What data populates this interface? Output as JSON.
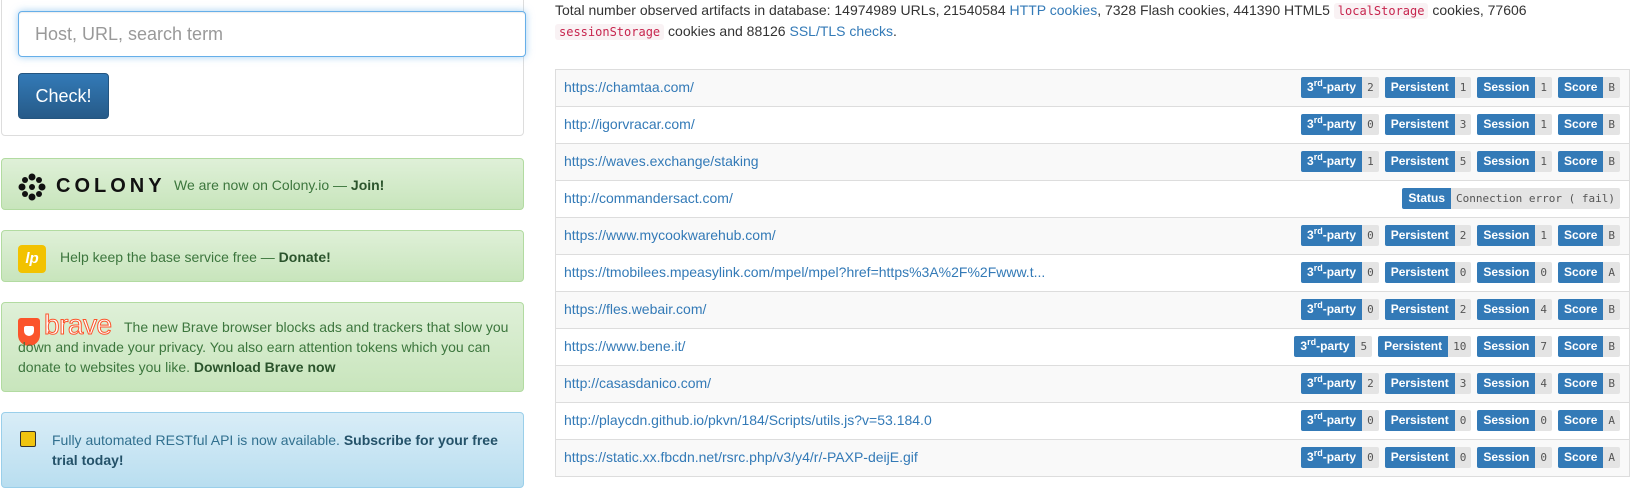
{
  "search": {
    "placeholder": "Host, URL, search term",
    "button_label": "Check!"
  },
  "colony": {
    "brand": "COLONY",
    "text": "We are now on Colony.io — ",
    "link": "Join!"
  },
  "donate": {
    "icon_text": "lp",
    "text": "Help keep the base service free — ",
    "link": "Donate!"
  },
  "brave": {
    "brand": "brave",
    "text": "The new Brave browser blocks ads and trackers that slow you down and invade your privacy. You also earn attention tokens which you can donate to websites you like. ",
    "link": "Download Brave now"
  },
  "api": {
    "text": "Fully automated RESTful API is now available. ",
    "link": "Subscribe for your free trial today!"
  },
  "stats": {
    "t1": "Total number observed artifacts in database: 14974989 URLs, 21540584 ",
    "l1": "HTTP cookies",
    "t2": ", 7328 Flash cookies, 441390 HTML5 ",
    "c1": "localStorage",
    "t3": " cookies, 77606 ",
    "c2": "sessionStorage",
    "t4": " cookies and 88126 ",
    "l2": "SSL/TLS checks",
    "t5": "."
  },
  "labels": {
    "third_sup": "rd",
    "third_pre": "3",
    "third_post": "-party",
    "persistent": "Persistent",
    "session": "Session",
    "score": "Score",
    "status": "Status"
  },
  "results": [
    {
      "url": "https://chamtaa.com/",
      "third": "2",
      "persistent": "1",
      "session": "1",
      "score": "B"
    },
    {
      "url": "http://igorvracar.com/",
      "third": "0",
      "persistent": "3",
      "session": "1",
      "score": "B"
    },
    {
      "url": "https://waves.exchange/staking",
      "third": "1",
      "persistent": "5",
      "session": "1",
      "score": "B"
    },
    {
      "url": "http://commandersact.com/",
      "status": "Connection error ( fail)"
    },
    {
      "url": "https://www.mycookwarehub.com/",
      "third": "0",
      "persistent": "2",
      "session": "1",
      "score": "B"
    },
    {
      "url": "https://tmobilees.mpeasylink.com/mpel/mpel?href=https%3A%2F%2Fwww.t...",
      "third": "0",
      "persistent": "0",
      "session": "0",
      "score": "A"
    },
    {
      "url": "https://fles.webair.com/",
      "third": "0",
      "persistent": "2",
      "session": "4",
      "score": "B"
    },
    {
      "url": "https://www.bene.it/",
      "third": "5",
      "persistent": "10",
      "session": "7",
      "score": "B"
    },
    {
      "url": "http://casasdanico.com/",
      "third": "2",
      "persistent": "3",
      "session": "4",
      "score": "B"
    },
    {
      "url": "http://playcdn.github.io/pkvn/184/Scripts/utils.js?v=53.184.0",
      "third": "0",
      "persistent": "0",
      "session": "0",
      "score": "A"
    },
    {
      "url": "https://static.xx.fbcdn.net/rsrc.php/v3/y4/r/-PAXP-deijE.gif",
      "third": "0",
      "persistent": "0",
      "session": "0",
      "score": "A"
    }
  ]
}
